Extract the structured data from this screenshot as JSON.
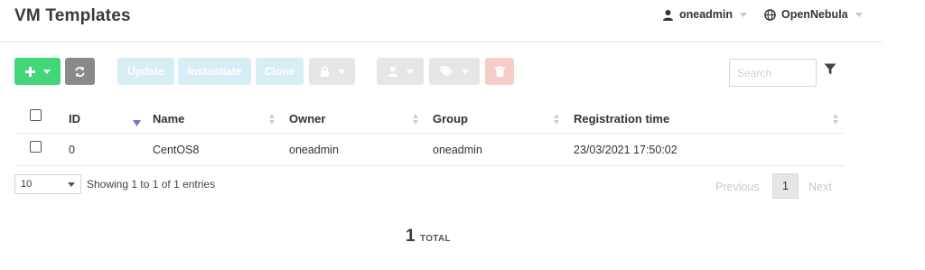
{
  "header": {
    "title": "VM Templates",
    "user": "oneadmin",
    "zone": "OpenNebula"
  },
  "toolbar": {
    "create_icon": "plus-icon",
    "refresh_icon": "refresh-icon",
    "update_label": "Update",
    "instantiate_label": "Instantiate",
    "clone_label": "Clone",
    "lock_icon": "lock-icon",
    "user_icon": "user-icon",
    "label_icon": "tags-icon",
    "delete_icon": "trash-icon",
    "search_placeholder": "Search",
    "filter_icon": "filter-icon"
  },
  "table": {
    "columns": [
      "ID",
      "Name",
      "Owner",
      "Group",
      "Registration time"
    ],
    "rows": [
      {
        "id": "0",
        "name": "CentOS8",
        "owner": "oneadmin",
        "group": "oneadmin",
        "registration_time": "23/03/2021 17:50:02"
      }
    ]
  },
  "footer": {
    "page_length": "10",
    "info": "Showing 1 to 1 of 1 entries",
    "previous": "Previous",
    "current_page": "1",
    "next": "Next"
  },
  "summary": {
    "count": "1",
    "label": "TOTAL"
  },
  "colors": {
    "create": "#43d67a",
    "refresh": "#8a8a8a",
    "action_disabled": "#d8eef7",
    "neutral_disabled": "#e6e6e6",
    "delete_disabled": "#f6cdc8",
    "sort_active": "#7b6fd6"
  }
}
